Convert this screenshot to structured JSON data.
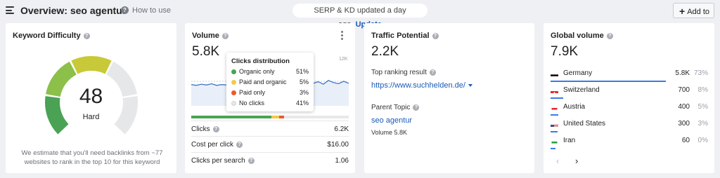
{
  "header": {
    "title": "Overview: seo agentur",
    "help_icon": "?",
    "how_to": "How to use",
    "notice_text": "SERP & KD updated a day ago.",
    "notice_action": "Update",
    "add_button_label": "Add to"
  },
  "keyword_difficulty": {
    "title": "Keyword Difficulty",
    "value": "48",
    "label": "Hard",
    "description": "We estimate that you'll need backlinks from ~77 websites to rank in the top 10 for this keyword",
    "gauge_colors": [
      "#4aa354",
      "#8cc04a",
      "#c8c938",
      "#e6e7e9",
      "#e6e7e9"
    ],
    "gauge_level": 0.48
  },
  "volume": {
    "title": "Volume",
    "value": "5.8K",
    "y_max_label": "12K",
    "trend_values": [
      5.2,
      5.0,
      5.3,
      5.1,
      5.4,
      5.0,
      5.2,
      5.1,
      5.3,
      5.0,
      5.2,
      5.5,
      5.6,
      5.2,
      6.0,
      5.4,
      5.8,
      5.3,
      6.1,
      5.6,
      5.3,
      5.9,
      5.4,
      6.3,
      5.5,
      5.9,
      5.3,
      6.2,
      5.7,
      5.4,
      6.0,
      5.5
    ],
    "tooltip": {
      "title": "Clicks distribution",
      "rows": [
        {
          "label": "Organic only",
          "pct": "51%",
          "color": "#4aa354"
        },
        {
          "label": "Paid and organic",
          "pct": "5%",
          "color": "#f2c94c"
        },
        {
          "label": "Paid only",
          "pct": "3%",
          "color": "#eb5a2a"
        },
        {
          "label": "No clicks",
          "pct": "41%",
          "color": "#e6e7e9"
        }
      ]
    },
    "distribution": [
      {
        "share": 0.51,
        "color": "#4aa354"
      },
      {
        "share": 0.05,
        "color": "#f2c94c"
      },
      {
        "share": 0.03,
        "color": "#eb5a2a"
      },
      {
        "share": 0.41,
        "color": "#e7e8ea"
      }
    ],
    "metrics": [
      {
        "label": "Clicks",
        "value": "6.2K"
      },
      {
        "label": "Cost per click",
        "value": "$16.00"
      },
      {
        "label": "Clicks per search",
        "value": "1.06"
      }
    ]
  },
  "traffic_potential": {
    "title": "Traffic Potential",
    "value": "2.2K",
    "top_result_label": "Top ranking result",
    "top_result_url": "https://www.suchhelden.de/",
    "parent_topic_label": "Parent Topic",
    "parent_topic": "seo agentur",
    "parent_volume": "Volume 5.8K"
  },
  "global_volume": {
    "title": "Global volume",
    "value": "7.9K",
    "countries": [
      {
        "name": "Germany",
        "value": "5.8K",
        "pct": "73%",
        "share": 0.73,
        "flag": "de"
      },
      {
        "name": "Switzerland",
        "value": "700",
        "pct": "8%",
        "share": 0.08,
        "flag": "ch"
      },
      {
        "name": "Austria",
        "value": "400",
        "pct": "5%",
        "share": 0.05,
        "flag": "at"
      },
      {
        "name": "United States",
        "value": "300",
        "pct": "3%",
        "share": 0.03,
        "flag": "us"
      },
      {
        "name": "Iran",
        "value": "60",
        "pct": "0%",
        "share": 0.0,
        "flag": "ir"
      }
    ],
    "prev_icon": "‹",
    "next_icon": "›"
  },
  "colors": {
    "accent_blue": "#1b5bb8",
    "bar_blue": "#3b7be8",
    "line_blue": "#3f76c7"
  }
}
